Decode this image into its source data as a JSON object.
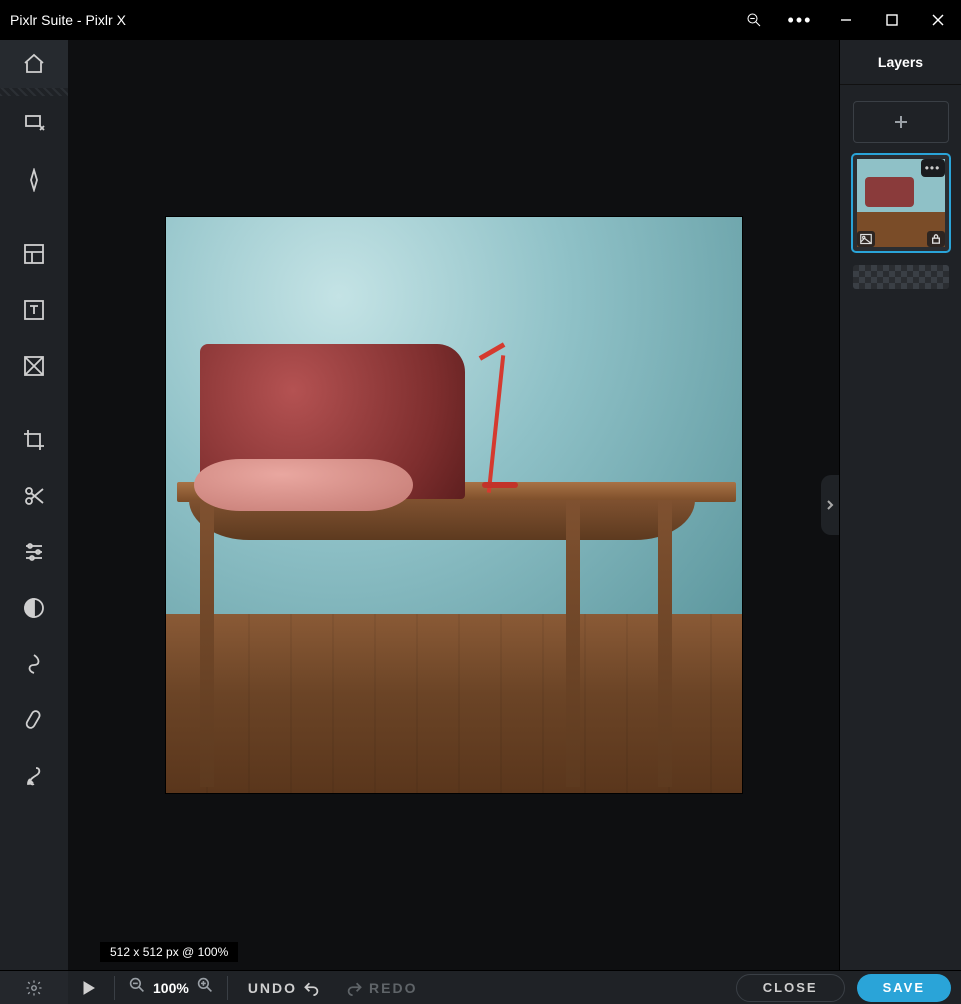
{
  "titlebar": {
    "title": "Pixlr Suite - Pixlr X"
  },
  "canvas": {
    "dimensions_label": "512 x 512 px @ 100%"
  },
  "layers_panel": {
    "title": "Layers"
  },
  "bottombar": {
    "zoom_label": "100%",
    "undo_label": "UNDO",
    "redo_label": "REDO",
    "close_label": "CLOSE",
    "save_label": "SAVE"
  }
}
